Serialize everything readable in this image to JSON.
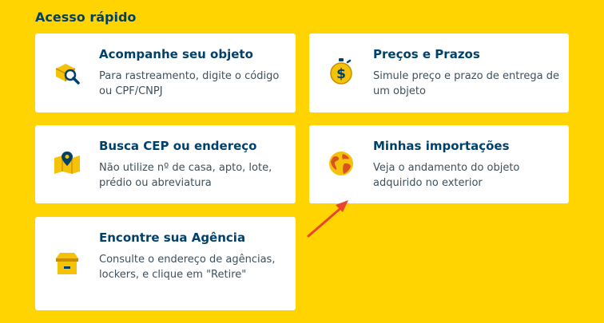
{
  "section": {
    "title": "Acesso rápido"
  },
  "cards": [
    {
      "title": "Acompanhe seu objeto",
      "description": "Para rastreamento, digite o código ou CPF/CNPJ",
      "icon": "package-search-icon"
    },
    {
      "title": "Preços e Prazos",
      "description": "Simule preço e prazo de entrega de um objeto",
      "icon": "stopwatch-dollar-icon"
    },
    {
      "title": "Busca CEP ou endereço",
      "description": "Não utilize nº de casa, apto, lote, prédio ou abreviatura",
      "icon": "map-pin-icon"
    },
    {
      "title": "Minhas importações",
      "description": "Veja o andamento do objeto adquirido no exterior",
      "icon": "globe-icon"
    },
    {
      "title": "Encontre sua Agência",
      "description": "Consulte o endereço de agências, lockers, e clique em \"Retire\"",
      "icon": "agency-building-icon"
    }
  ],
  "colors": {
    "background": "#FFD400",
    "title": "#00416B",
    "text": "#3D4F5C",
    "icon_yellow": "#F5C20A",
    "icon_blue": "#00416B",
    "arrow": "#E8452C"
  }
}
